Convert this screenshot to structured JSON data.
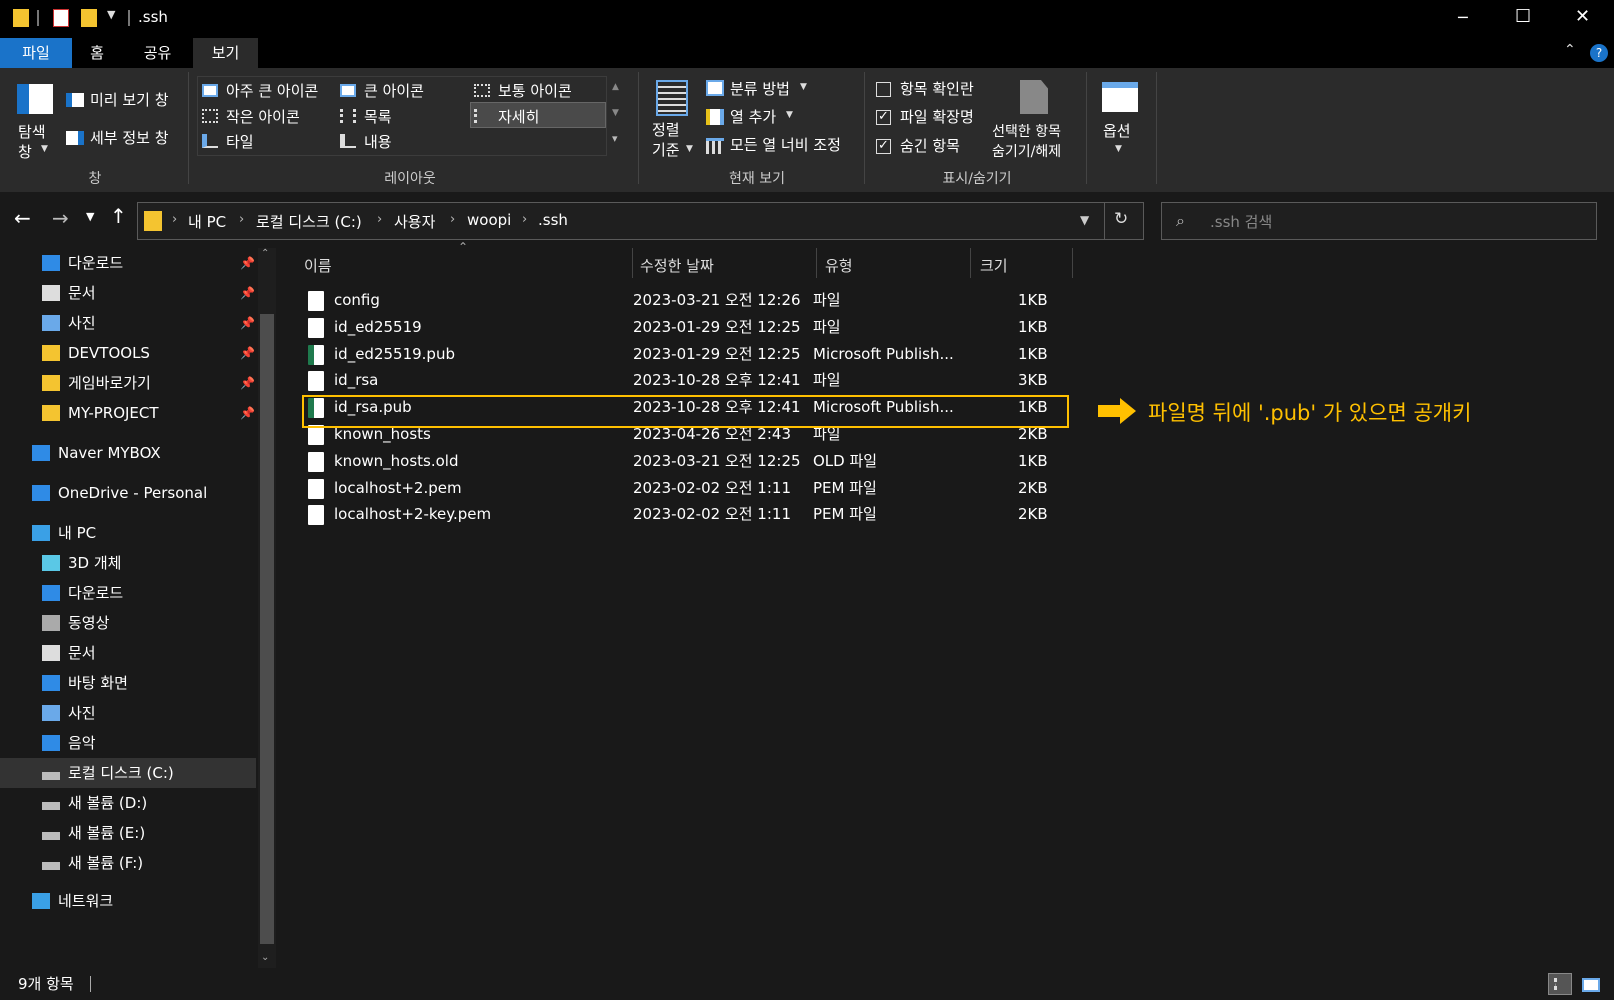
{
  "window": {
    "title": ".ssh",
    "minimize": "─",
    "maximize": "☐",
    "close": "✕"
  },
  "tabs": [
    "파일",
    "홈",
    "공유",
    "보기"
  ],
  "ribbon": {
    "pane": {
      "nav_pane": "탐색\n창",
      "preview": "미리 보기 창",
      "details": "세부 정보 창",
      "group": "창"
    },
    "layout": {
      "items": [
        "아주 큰 아이콘",
        "큰 아이콘",
        "보통 아이콘",
        "작은 아이콘",
        "목록",
        "자세히",
        "타일",
        "내용"
      ],
      "group": "레이아웃"
    },
    "current": {
      "sort": "정렬\n기준",
      "group_by": "분류 방법",
      "add_col": "열 추가",
      "fit_cols": "모든 열 너비 조정",
      "group": "현재 보기"
    },
    "showhide": {
      "checkboxes": "항목 확인란",
      "extensions": "파일 확장명",
      "hidden": "숨긴 항목",
      "hide_sel": "선택한 항목\n숨기기/해제",
      "group": "표시/숨기기"
    },
    "options": "옵션"
  },
  "address": {
    "crumbs": [
      "내 PC",
      "로컬 디스크 (C:)",
      "사용자",
      "woopi",
      ".ssh"
    ],
    "search_placeholder": ".ssh 검색"
  },
  "nav": [
    {
      "label": "다운로드",
      "icon": "download-icon",
      "pin": true,
      "indent": 1
    },
    {
      "label": "문서",
      "icon": "document-icon",
      "pin": true,
      "indent": 1
    },
    {
      "label": "사진",
      "icon": "picture-icon",
      "pin": true,
      "indent": 1
    },
    {
      "label": "DEVTOOLS",
      "icon": "folder-icon",
      "pin": true,
      "indent": 1
    },
    {
      "label": "게임바로가기",
      "icon": "folder-icon",
      "pin": true,
      "indent": 1
    },
    {
      "label": "MY-PROJECT",
      "icon": "folder-icon",
      "pin": true,
      "indent": 1
    },
    {
      "label": "Naver MYBOX",
      "icon": "cloud-box-icon",
      "pin": false,
      "indent": 0
    },
    {
      "label": "OneDrive - Personal",
      "icon": "onedrive-icon",
      "pin": false,
      "indent": 0
    },
    {
      "label": "내 PC",
      "icon": "pc-icon",
      "pin": false,
      "indent": 0
    },
    {
      "label": "3D 개체",
      "icon": "3d-icon",
      "pin": false,
      "indent": 1
    },
    {
      "label": "다운로드",
      "icon": "download-icon",
      "pin": false,
      "indent": 1
    },
    {
      "label": "동영상",
      "icon": "video-icon",
      "pin": false,
      "indent": 1
    },
    {
      "label": "문서",
      "icon": "document-icon",
      "pin": false,
      "indent": 1
    },
    {
      "label": "바탕 화면",
      "icon": "desktop-icon",
      "pin": false,
      "indent": 1
    },
    {
      "label": "사진",
      "icon": "picture-icon",
      "pin": false,
      "indent": 1
    },
    {
      "label": "음악",
      "icon": "music-icon",
      "pin": false,
      "indent": 1
    },
    {
      "label": "로컬 디스크 (C:)",
      "icon": "drive-icon",
      "pin": false,
      "indent": 1,
      "selected": true
    },
    {
      "label": "새 볼륨 (D:)",
      "icon": "drive-icon",
      "pin": false,
      "indent": 1
    },
    {
      "label": "새 볼륨 (E:)",
      "icon": "drive-icon",
      "pin": false,
      "indent": 1
    },
    {
      "label": "새 볼륨 (F:)",
      "icon": "drive-icon",
      "pin": false,
      "indent": 1
    },
    {
      "label": "네트워크",
      "icon": "network-icon",
      "pin": false,
      "indent": 0
    }
  ],
  "columns": [
    "이름",
    "수정한 날짜",
    "유형",
    "크기"
  ],
  "files": [
    {
      "name": "config",
      "date": "2023-03-21 오전 12:26",
      "type": "파일",
      "size": "1KB",
      "pub": false
    },
    {
      "name": "id_ed25519",
      "date": "2023-01-29 오전 12:25",
      "type": "파일",
      "size": "1KB",
      "pub": false
    },
    {
      "name": "id_ed25519.pub",
      "date": "2023-01-29 오전 12:25",
      "type": "Microsoft Publish...",
      "size": "1KB",
      "pub": true
    },
    {
      "name": "id_rsa",
      "date": "2023-10-28 오후 12:41",
      "type": "파일",
      "size": "3KB",
      "pub": false
    },
    {
      "name": "id_rsa.pub",
      "date": "2023-10-28 오후 12:41",
      "type": "Microsoft Publish...",
      "size": "1KB",
      "pub": true
    },
    {
      "name": "known_hosts",
      "date": "2023-04-26 오전 2:43",
      "type": "파일",
      "size": "2KB",
      "pub": false
    },
    {
      "name": "known_hosts.old",
      "date": "2023-03-21 오전 12:25",
      "type": "OLD 파일",
      "size": "1KB",
      "pub": false
    },
    {
      "name": "localhost+2.pem",
      "date": "2023-02-02 오전 1:11",
      "type": "PEM 파일",
      "size": "2KB",
      "pub": false
    },
    {
      "name": "localhost+2-key.pem",
      "date": "2023-02-02 오전 1:11",
      "type": "PEM 파일",
      "size": "2KB",
      "pub": false
    }
  ],
  "annotation": {
    "text": "파일명 뒤에 '.pub' 가 있으면 공개키",
    "color": "#ffc000"
  },
  "status": {
    "count": "9개 항목"
  }
}
